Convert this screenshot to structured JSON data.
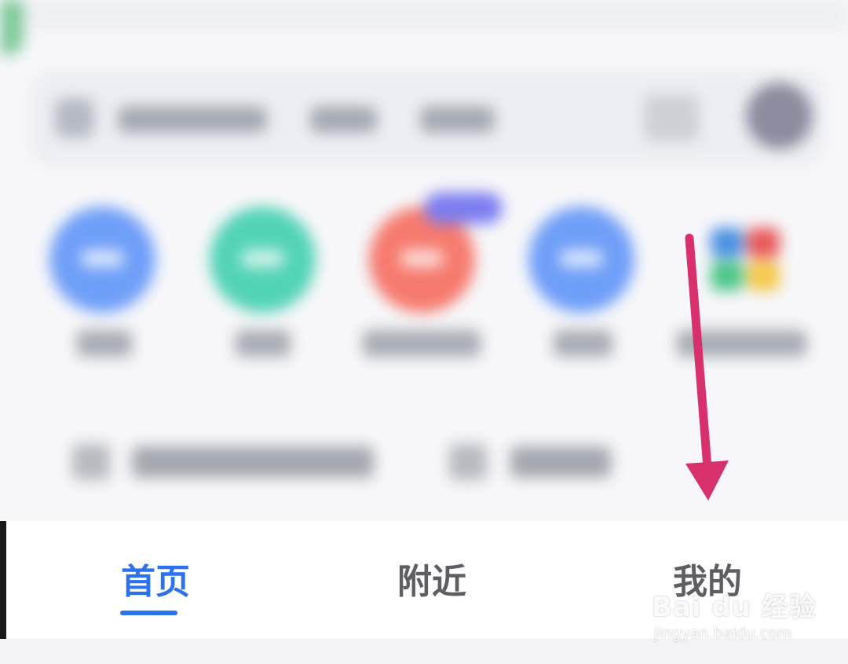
{
  "tabbar": {
    "tabs": [
      {
        "label": "首页",
        "state": "active"
      },
      {
        "label": "附近",
        "state": "inactive"
      },
      {
        "label": "我的",
        "state": "inactive"
      }
    ],
    "active_color": "#2b72f0",
    "inactive_color": "#5d5d63"
  },
  "quick_actions": {
    "circle_colors": [
      "#6f9ef8",
      "#52d3b5",
      "#f67a6e",
      "#6f9ef8"
    ],
    "badge_color": "#7c7cf0"
  },
  "annotation": {
    "arrow_color": "#d8306d",
    "points_to": "tab-mine"
  },
  "watermark": {
    "main": "Bai du 经验",
    "sub": "jingyan.baidu.com"
  }
}
